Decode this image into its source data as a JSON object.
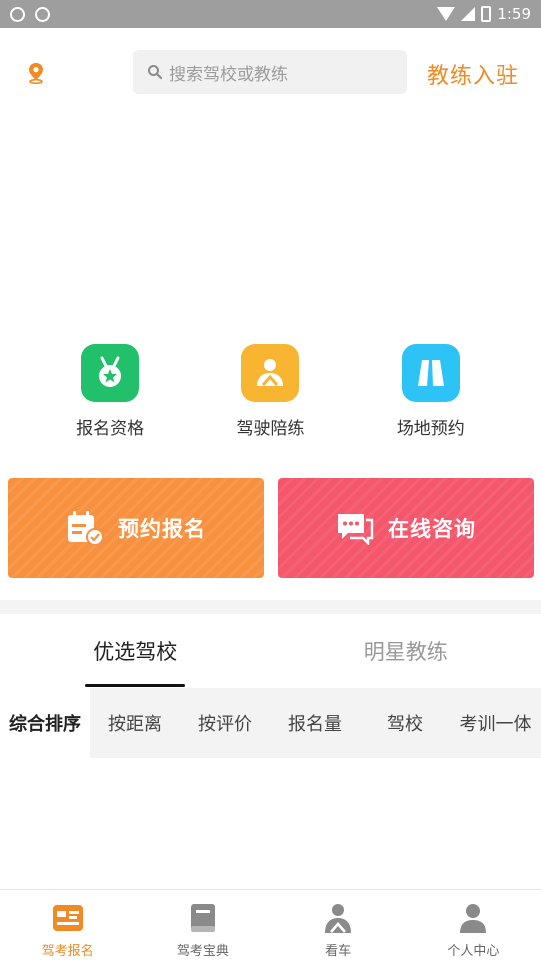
{
  "status_bar": {
    "time": "1:59"
  },
  "header": {
    "search_placeholder": "搜索驾校或教练",
    "coach_join": "教练入驻"
  },
  "features": [
    {
      "label": "报名资格",
      "icon": "medal-star-icon",
      "color": "#22c06a"
    },
    {
      "label": "驾驶陪练",
      "icon": "driver-icon",
      "color": "#f8b531"
    },
    {
      "label": "场地预约",
      "icon": "road-field-icon",
      "color": "#2ec3f7"
    }
  ],
  "actions": [
    {
      "label": "预约报名",
      "icon": "calendar-check-icon",
      "color": "#f7913f"
    },
    {
      "label": "在线咨询",
      "icon": "chat-bubble-icon",
      "color": "#f4566b"
    }
  ],
  "tabs": [
    {
      "label": "优选驾校",
      "active": true
    },
    {
      "label": "明星教练",
      "active": false
    }
  ],
  "sort_options": [
    "综合排序",
    "按距离",
    "按评价",
    "报名量",
    "驾校",
    "考训一体"
  ],
  "bottom_nav": [
    {
      "label": "驾考报名",
      "icon": "id-card-icon",
      "active": true
    },
    {
      "label": "驾考宝典",
      "icon": "book-icon",
      "active": false
    },
    {
      "label": "看车",
      "icon": "car-driver-icon",
      "active": false
    },
    {
      "label": "个人中心",
      "icon": "person-icon",
      "active": false
    }
  ],
  "colors": {
    "accent": "#f08a24"
  }
}
